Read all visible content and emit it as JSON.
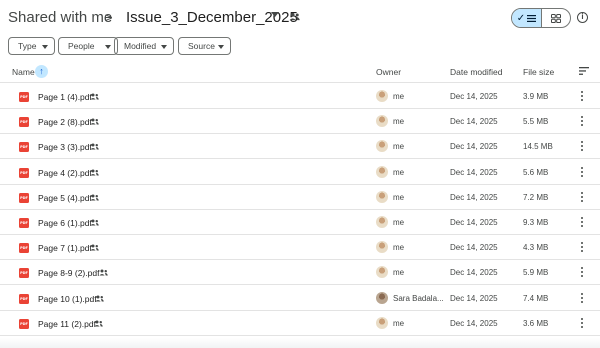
{
  "breadcrumb": {
    "root": "Shared with me",
    "separator": ">",
    "current": "Issue_3_December_2025"
  },
  "view_toggle": {
    "list_active": true
  },
  "filters": [
    {
      "label": "Type"
    },
    {
      "label": "People"
    },
    {
      "label": "Modified"
    },
    {
      "label": "Source"
    }
  ],
  "columns": {
    "name": "Name",
    "owner": "Owner",
    "date_modified": "Date modified",
    "file_size": "File size"
  },
  "files": [
    {
      "name": "Page 1 (4).pdf",
      "owner": "me",
      "date": "Dec 14, 2025",
      "size": "3.9 MB",
      "avatar": "default"
    },
    {
      "name": "Page 2 (8).pdf",
      "owner": "me",
      "date": "Dec 14, 2025",
      "size": "5.5 MB",
      "avatar": "default"
    },
    {
      "name": "Page 3 (3).pdf",
      "owner": "me",
      "date": "Dec 14, 2025",
      "size": "14.5 MB",
      "avatar": "default"
    },
    {
      "name": "Page 4 (2).pdf",
      "owner": "me",
      "date": "Dec 14, 2025",
      "size": "5.6 MB",
      "avatar": "default"
    },
    {
      "name": "Page 5 (4).pdf",
      "owner": "me",
      "date": "Dec 14, 2025",
      "size": "7.2 MB",
      "avatar": "default"
    },
    {
      "name": "Page 6 (1).pdf",
      "owner": "me",
      "date": "Dec 14, 2025",
      "size": "9.3 MB",
      "avatar": "default"
    },
    {
      "name": "Page 7 (1).pdf",
      "owner": "me",
      "date": "Dec 14, 2025",
      "size": "4.3 MB",
      "avatar": "default"
    },
    {
      "name": "Page 8-9 (2).pdf",
      "owner": "me",
      "date": "Dec 14, 2025",
      "size": "5.9 MB",
      "avatar": "default"
    },
    {
      "name": "Page 10 (1).pdf",
      "owner": "Sara Badala...",
      "date": "Dec 14, 2025",
      "size": "7.4 MB",
      "avatar": "alt"
    },
    {
      "name": "Page 11 (2).pdf",
      "owner": "me",
      "date": "Dec 14, 2025",
      "size": "3.6 MB",
      "avatar": "default"
    }
  ],
  "colors": {
    "accent": "#0b57d0",
    "selected_bg": "#c2e7ff",
    "pdf_red": "#ea4335"
  },
  "icons": {
    "file": "pdf-icon",
    "shared": "people-icon",
    "menu": "more-vert-icon",
    "sort": "arrow-up-icon",
    "info": "info-icon"
  }
}
